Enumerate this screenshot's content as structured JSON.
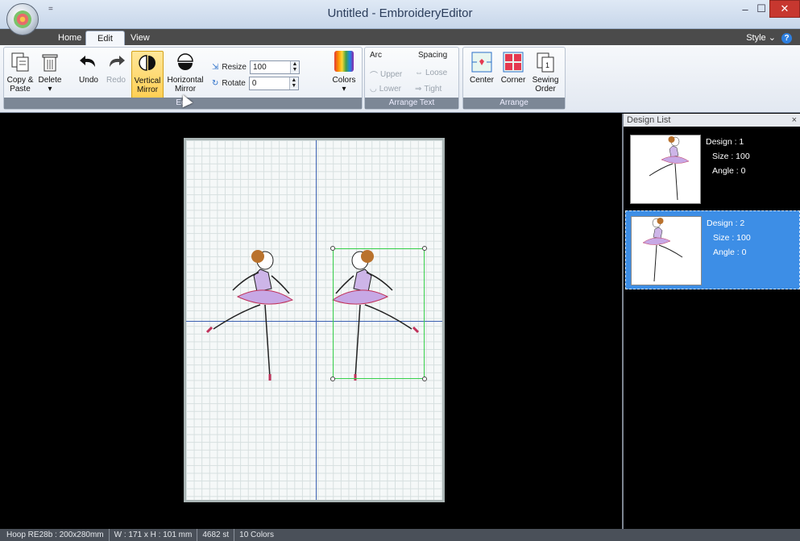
{
  "window": {
    "title": "Untitled - EmbroideryEditor",
    "qat_glyph": "=",
    "min_glyph": "–",
    "max_glyph": "☐",
    "close_glyph": "✕"
  },
  "tabs": {
    "home": "Home",
    "edit": "Edit",
    "view": "View",
    "style": "Style",
    "style_arrow": "⌄",
    "help": "?"
  },
  "ribbon": {
    "edit_group": {
      "label": "Edit",
      "copy_paste": "Copy &\nPaste",
      "delete": "Delete",
      "delete_arrow": "▾",
      "undo": "Undo",
      "redo": "Redo",
      "vertical_mirror": "Vertical\nMirror",
      "horizontal_mirror": "Horizontal\nMirror",
      "resize_label": "Resize",
      "resize_value": "100",
      "rotate_label": "Rotate",
      "rotate_value": "0",
      "colors": "Colors",
      "colors_arrow": "▾"
    },
    "arrange_text_group": {
      "label": "Arrange Text",
      "arc": "Arc",
      "upper": "Upper",
      "lower": "Lower",
      "spacing": "Spacing",
      "loose": "Loose",
      "tight": "Tight"
    },
    "arrange_group": {
      "label": "Arrange",
      "center": "Center",
      "corner": "Corner",
      "sewing_order": "Sewing\nOrder"
    }
  },
  "design_list": {
    "title": "Design List",
    "close": "×",
    "items": [
      {
        "design": "Design : 1",
        "size": "Size : 100",
        "angle": "Angle : 0",
        "selected": false
      },
      {
        "design": "Design : 2",
        "size": "Size : 100",
        "angle": "Angle : 0",
        "selected": true
      }
    ]
  },
  "status": {
    "hoop": "Hoop RE28b : 200x280mm",
    "dims": "W : 171 x H : 101 mm",
    "stitches": "4682 st",
    "colors": "10 Colors"
  },
  "colors": {
    "accent": "#3d8ee6",
    "selection": "#36d04a",
    "axis": "#3a5fb0",
    "close": "#c7372f"
  }
}
